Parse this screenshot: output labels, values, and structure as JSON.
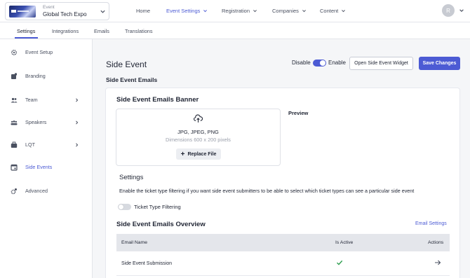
{
  "header": {
    "event_label": "Event",
    "event_name": "Global Tech Expo",
    "nav": [
      {
        "label": "Home"
      },
      {
        "label": "Event Settings"
      },
      {
        "label": "Registration"
      },
      {
        "label": "Companies"
      },
      {
        "label": "Content"
      }
    ],
    "avatar_initial": "R",
    "accent_color": "#4c5bd4"
  },
  "subtabs": [
    {
      "label": "Settings"
    },
    {
      "label": "Integrations"
    },
    {
      "label": "Emails"
    },
    {
      "label": "Translations"
    }
  ],
  "sidebar": {
    "items": [
      {
        "label": "Event Setup",
        "icon": "gear-icon"
      },
      {
        "label": "Branding",
        "icon": "palette-icon"
      },
      {
        "label": "Team",
        "icon": "team-icon"
      },
      {
        "label": "Speakers",
        "icon": "speakers-icon"
      },
      {
        "label": "LQT",
        "icon": "briefcase-icon"
      },
      {
        "label": "Side Events",
        "icon": "calendar-icon"
      },
      {
        "label": "Advanced",
        "icon": "advanced-gear-icon"
      }
    ],
    "active": "Side Events"
  },
  "main": {
    "title": "Side Event",
    "subtitle": "Side Event Emails",
    "toggle_off_label": "Disable",
    "toggle_on_label": "Enable",
    "open_widget_label": "Open Side Event Widget",
    "save_label": "Save Changes",
    "banner": {
      "title": "Side Event Emails Banner",
      "formats": "JPG, JPEG, PNG",
      "dimensions": "Dimensions 600 x 200 pixels",
      "replace_label": "Replace File",
      "preview_label": "Preview"
    },
    "settings": {
      "title": "Settings",
      "description": "Enable the ticket type filtering if you want side event submitters to be able to select which ticket types can see a particular side event",
      "ticket_filter_label": "Ticket Type Filtering"
    },
    "overview": {
      "title": "Side Event Emails Overview",
      "settings_link": "Email Settings",
      "columns": [
        "Email Name",
        "Is Active",
        "Actions"
      ],
      "rows": [
        {
          "name": "Side Event Submission",
          "active": true
        }
      ]
    }
  }
}
